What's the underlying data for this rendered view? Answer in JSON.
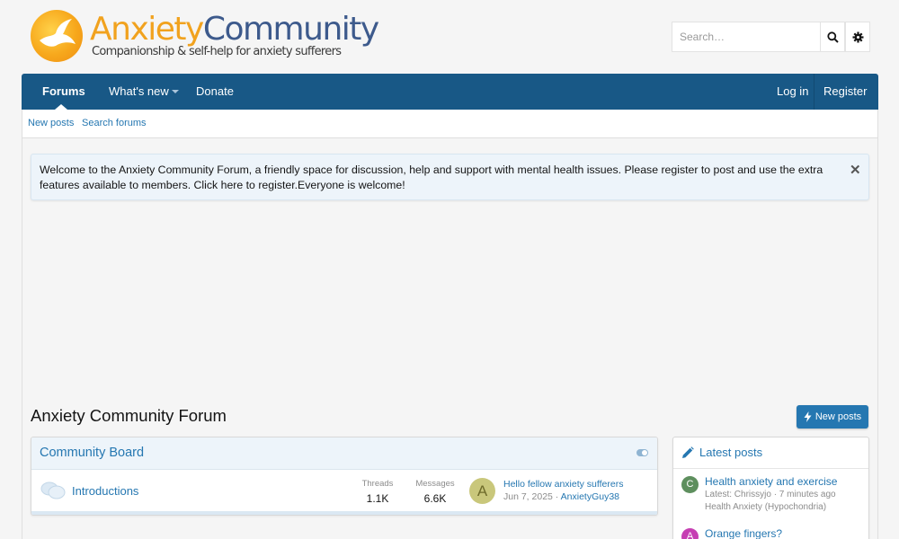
{
  "brand": {
    "title_part1": "Anxiety",
    "title_part2": "Community",
    "tagline": "Companionship & self-help for anxiety sufferers",
    "logo_icon": "dove-icon",
    "colors": {
      "orange": "#f1a21e",
      "blue": "#3d5a8c"
    }
  },
  "search": {
    "placeholder": "Search…",
    "search_icon": "search-icon",
    "settings_icon": "gear-icon"
  },
  "nav": {
    "items": [
      {
        "label": "Forums",
        "active": true
      },
      {
        "label": "What's new",
        "has_menu": true
      },
      {
        "label": "Donate"
      }
    ],
    "login_label": "Log in",
    "register_label": "Register",
    "color": "#185886"
  },
  "subnav": {
    "items": [
      "New posts",
      "Search forums"
    ]
  },
  "notice": {
    "text": "Welcome to the Anxiety Community Forum, a friendly space for discussion, help and support with mental health issues. Please register to post and use the extra features available to members. Click here to register.Everyone is welcome!",
    "close_label": "✕"
  },
  "main": {
    "title": "Anxiety Community Forum",
    "new_posts_button": "New posts"
  },
  "board": {
    "title": "Community Board",
    "forums": [
      {
        "title": "Introductions",
        "threads_label": "Threads",
        "threads": "1.1K",
        "messages_label": "Messages",
        "messages": "6.6K",
        "latest": {
          "avatar_letter": "A",
          "title": "Hello fellow anxiety sufferers",
          "date": "Jun 7, 2025",
          "separator": " · ",
          "user": "AnxietyGuy38"
        }
      }
    ]
  },
  "sidebar": {
    "title": "Latest posts",
    "posts": [
      {
        "avatar_letter": "C",
        "avatar_color": "#5e8f5e",
        "title": "Health anxiety and exercise",
        "meta": "Latest: Chrissyjo · 7 minutes ago",
        "forum": "Health Anxiety (Hypochondria)"
      },
      {
        "avatar_letter": "A",
        "avatar_color": "#c63fb3",
        "title": "Orange fingers?"
      }
    ]
  }
}
